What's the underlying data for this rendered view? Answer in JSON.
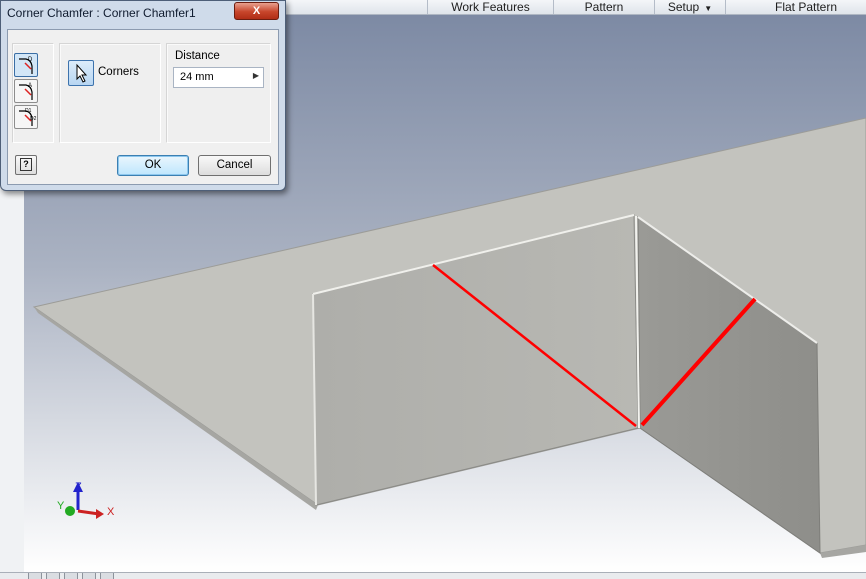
{
  "ribbon": {
    "tabs": [
      {
        "label": "Work Features"
      },
      {
        "label": "Pattern"
      },
      {
        "label": "Setup",
        "dropdown": true
      },
      {
        "label": "Flat Pattern"
      }
    ]
  },
  "dialog": {
    "title": "Corner Chamfer : Corner Chamfer1",
    "close_label": "X",
    "modes": [
      "distance-mode-icon",
      "distance-angle-mode-icon",
      "two-distance-mode-icon"
    ],
    "corners_label": "Corners",
    "distance_label": "Distance",
    "distance_value": "24 mm",
    "ok_label": "OK",
    "cancel_label": "Cancel",
    "help_label": "?"
  },
  "triad": {
    "x_label": "X",
    "y_label": "Y",
    "z_label": "Z"
  },
  "colors": {
    "viewport_top": "#7d8aa4",
    "viewport_bottom": "#ffffff",
    "sheet_top": "#c2c2bd",
    "wall_left": "#b2b2ad",
    "wall_right": "#9b9b97",
    "chamfer_edge": "#ff0000",
    "axis_x": "#cc2222",
    "axis_y": "#22aa22",
    "axis_z": "#2222cc"
  }
}
